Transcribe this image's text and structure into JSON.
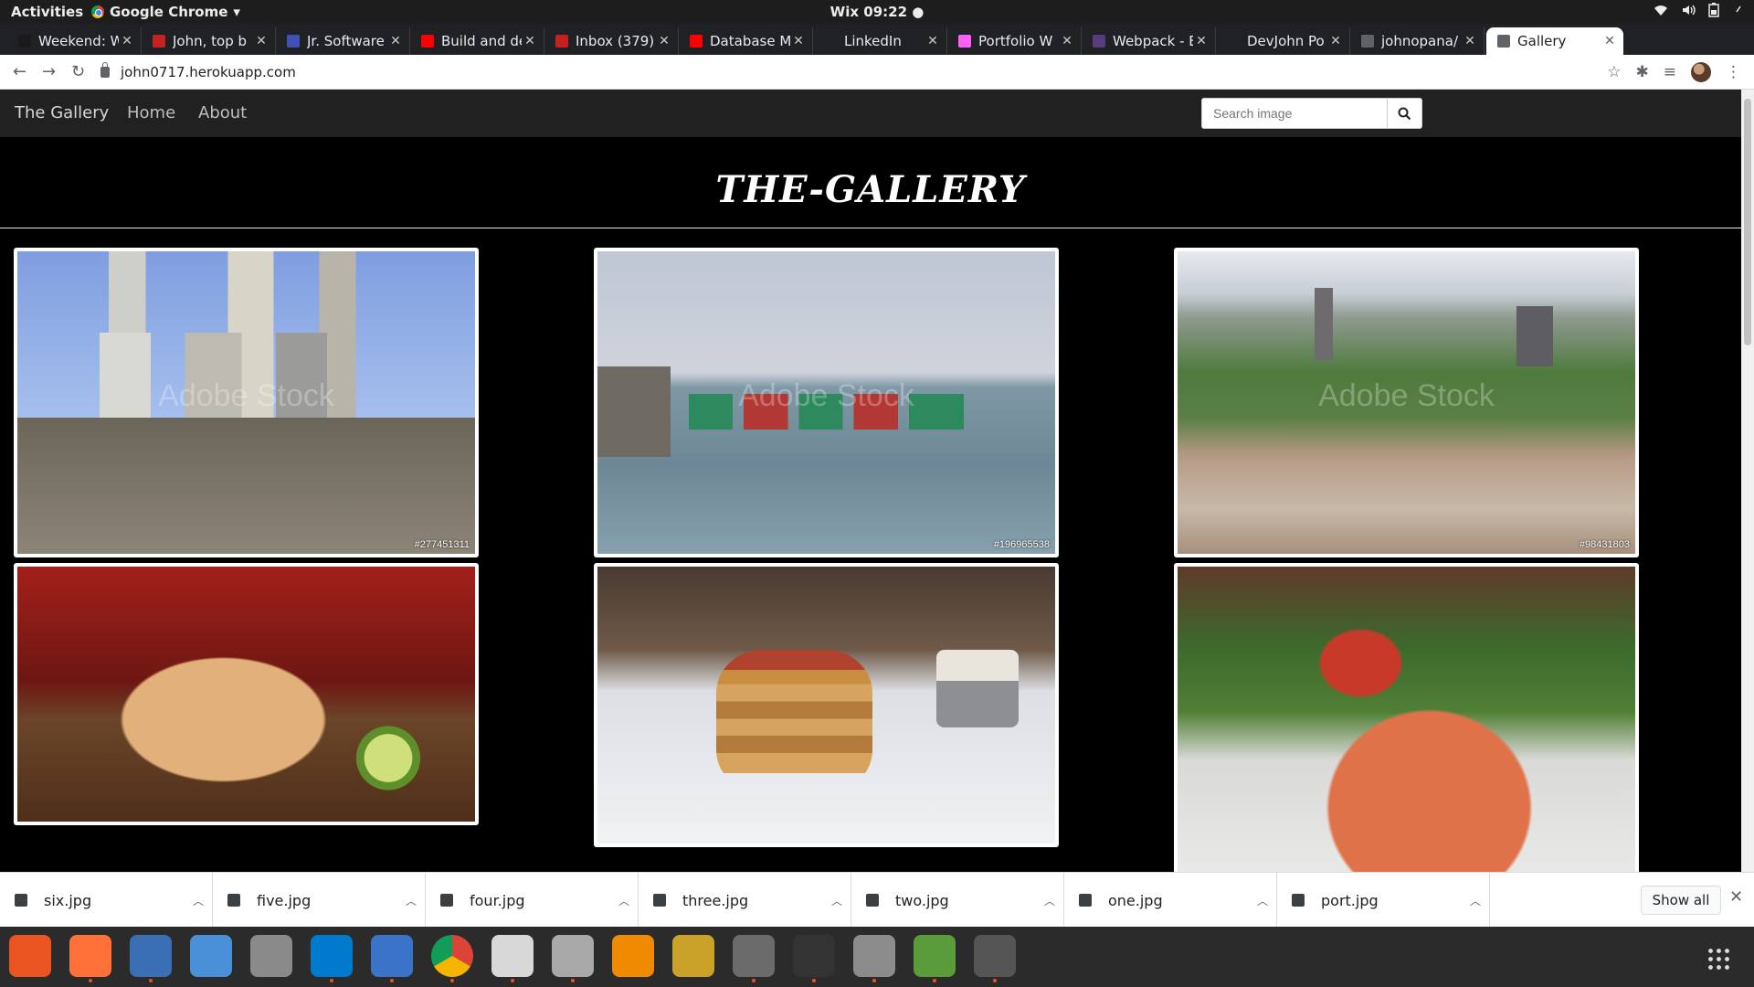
{
  "system_bar": {
    "activities": "Activities",
    "app_name": "Google Chrome",
    "app_dropdown_glyph": "▾",
    "clock": "Wix 09:22 ●",
    "icons": [
      "wifi-icon",
      "volume-icon",
      "battery-icon",
      "power-icon"
    ]
  },
  "tabs": [
    {
      "title": "Weekend: W",
      "favicon_color": "#1a1a1a"
    },
    {
      "title": "John, top b",
      "favicon_color": "#c5221f"
    },
    {
      "title": "Jr. Software",
      "favicon_color": "#3f51b5"
    },
    {
      "title": "Build and de",
      "favicon_color": "#ff0000"
    },
    {
      "title": "Inbox (379)",
      "favicon_color": "#c5221f"
    },
    {
      "title": "Database M",
      "favicon_color": "#ff0000"
    },
    {
      "title": "LinkedIn",
      "favicon_color": "#202124"
    },
    {
      "title": "Portfolio W",
      "favicon_color": "#ff61f6"
    },
    {
      "title": "Webpack - B",
      "favicon_color": "#563d7c"
    },
    {
      "title": "DevJohn Po",
      "favicon_color": "#202124"
    },
    {
      "title": "johnopana/",
      "favicon_color": "#5f6368"
    },
    {
      "title": "Gallery",
      "favicon_color": "#5f6368",
      "active": true
    }
  ],
  "omnibox": {
    "url": "john0717.herokuapp.com"
  },
  "site": {
    "brand": "The Gallery",
    "nav": [
      "Home",
      "About"
    ],
    "search_placeholder": "Search image",
    "heading": "THE-GALLERY",
    "watermark": "Adobe Stock",
    "images": [
      {
        "id": "#277451311",
        "subject": "city-square"
      },
      {
        "id": "#196965538",
        "subject": "fishing-boats"
      },
      {
        "id": "#98431803",
        "subject": "city-skyline"
      },
      {
        "id": "",
        "subject": "burrito"
      },
      {
        "id": "",
        "subject": "pancakes"
      },
      {
        "id": "",
        "subject": "salmon-salad"
      }
    ]
  },
  "downloads": {
    "files": [
      "six.jpg",
      "five.jpg",
      "four.jpg",
      "three.jpg",
      "two.jpg",
      "one.jpg",
      "port.jpg"
    ],
    "show_all": "Show all"
  },
  "dock": {
    "apps": [
      "ubuntu-software-icon",
      "firefox-icon",
      "text-editor-icon",
      "help-icon",
      "printer-icon",
      "vscode-icon",
      "thunderbird-icon",
      "chrome-icon",
      "evince-icon",
      "files-icon",
      "vlc-icon",
      "rhythmbox-icon",
      "video-editor-icon",
      "terminal-icon",
      "settings-icon",
      "image-viewer-icon",
      "software-updater-icon"
    ]
  }
}
